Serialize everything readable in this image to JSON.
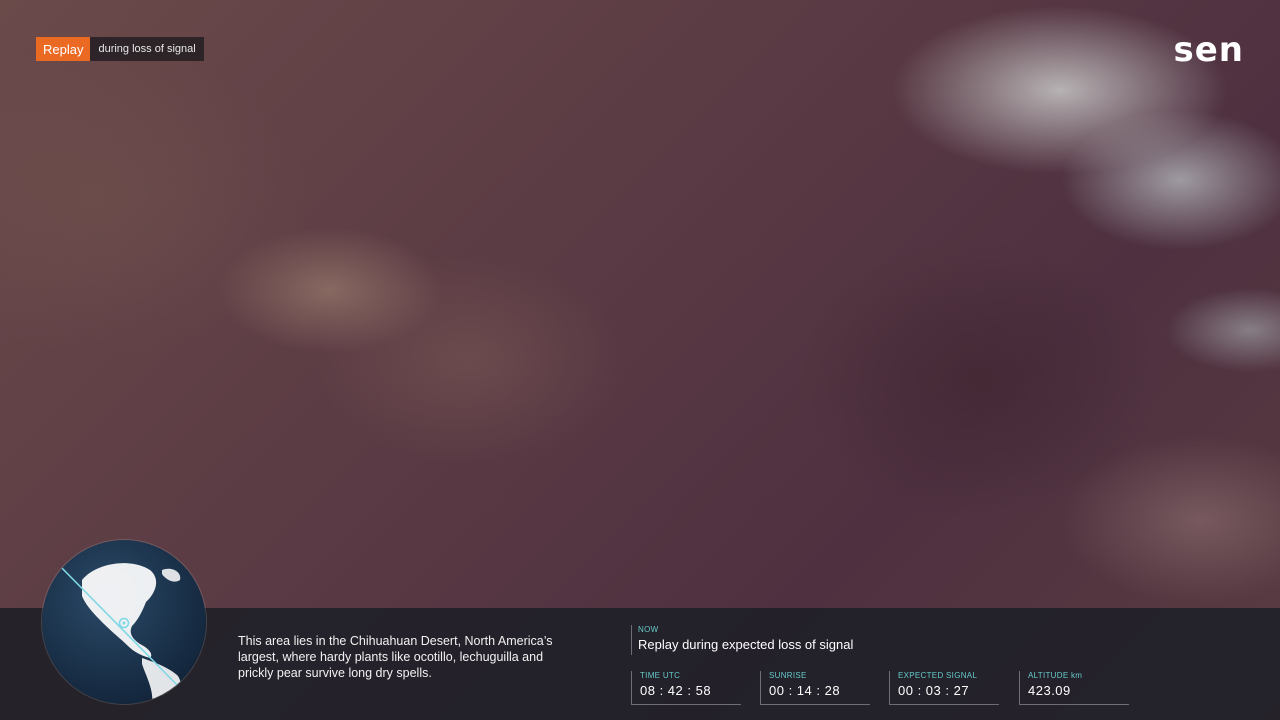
{
  "badge": {
    "replay": "Replay",
    "note": "during loss of signal"
  },
  "brand": {
    "logo": "sen"
  },
  "description": "This area lies in the Chihuahuan Desert, North America’s largest, where hardy plants like ocotillo, lechuguilla and prickly pear survive long dry spells.",
  "now": {
    "label": "NOW",
    "text": "Replay during expected loss of signal"
  },
  "stats": [
    {
      "label": "TIME UTC",
      "value": "08 : 42 : 58"
    },
    {
      "label": "SUNRISE",
      "value": "00 : 14 : 28"
    },
    {
      "label": "EXPECTED SIGNAL",
      "value": "00 : 03 : 27"
    },
    {
      "label": "ALTITUDE km",
      "value": "423.09"
    }
  ],
  "colors": {
    "accent": "#ea6a23",
    "label_teal": "#65c9c9",
    "orbit_line": "#7fd8e6"
  },
  "icons": {
    "globe": "globe-orbit-map"
  }
}
